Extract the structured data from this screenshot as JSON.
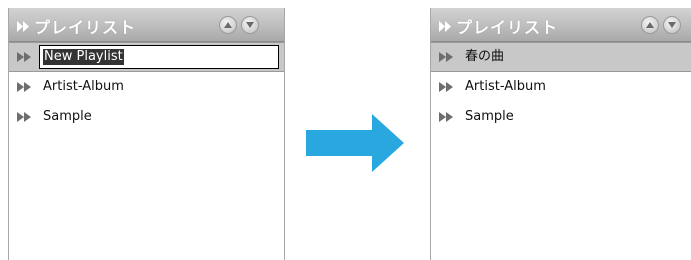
{
  "left_panel": {
    "header_title": "プレイリスト",
    "header_arrow_icon": "double-chevron-right-icon",
    "scroll_up_icon": "triangle-up-icon",
    "scroll_down_icon": "triangle-down-icon",
    "items": [
      {
        "label": "New Playlist",
        "state": "renaming"
      },
      {
        "label": "Artist-Album"
      },
      {
        "label": "Sample"
      }
    ]
  },
  "right_panel": {
    "header_title": "プレイリスト",
    "items": [
      {
        "label": "春の曲",
        "state": "selected"
      },
      {
        "label": "Artist-Album"
      },
      {
        "label": "Sample"
      }
    ]
  },
  "transition_arrow": {
    "icon": "arrow-right-icon",
    "color": "#29a8e0"
  },
  "colors": {
    "header_gradient_top": "#d3d3d3",
    "header_gradient_bottom": "#a9a9a9",
    "selected_row": "#c8c8c8",
    "selection_highlight": "#333333"
  }
}
